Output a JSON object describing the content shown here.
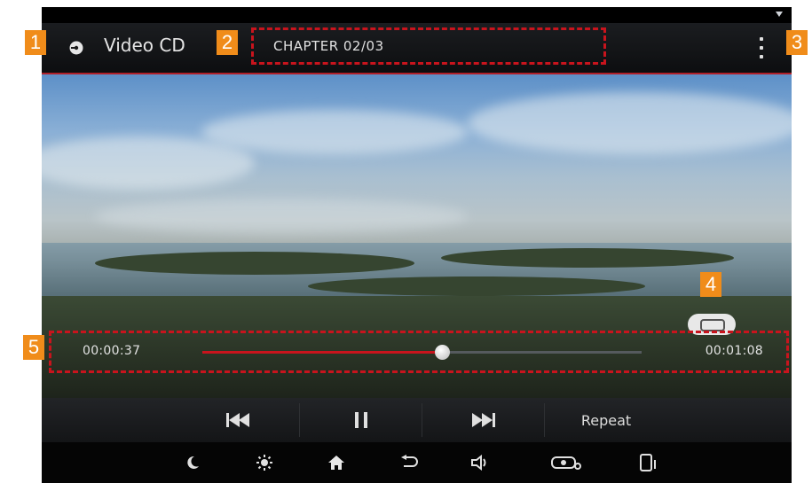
{
  "header": {
    "source": "Video CD",
    "chapter": "CHAPTER 02/03"
  },
  "playback": {
    "elapsed": "00:00:37",
    "total": "00:01:08",
    "progress_fraction": 0.545
  },
  "controls": {
    "repeat_label": "Repeat"
  },
  "callouts": [
    "1",
    "2",
    "3",
    "4",
    "5"
  ],
  "icons": {
    "source": "disc-icon",
    "menu": "more-vertical-icon",
    "repeat_toggle": "repeat-icon",
    "prev": "skip-previous-icon",
    "pause": "pause-icon",
    "next": "skip-next-icon",
    "nav": [
      "moon-icon",
      "brightness-icon",
      "home-icon",
      "back-icon",
      "volume-icon",
      "camera-car-icon",
      "phone-icon"
    ]
  },
  "colors": {
    "accent": "#c8141d",
    "callout": "#f08c1a"
  }
}
